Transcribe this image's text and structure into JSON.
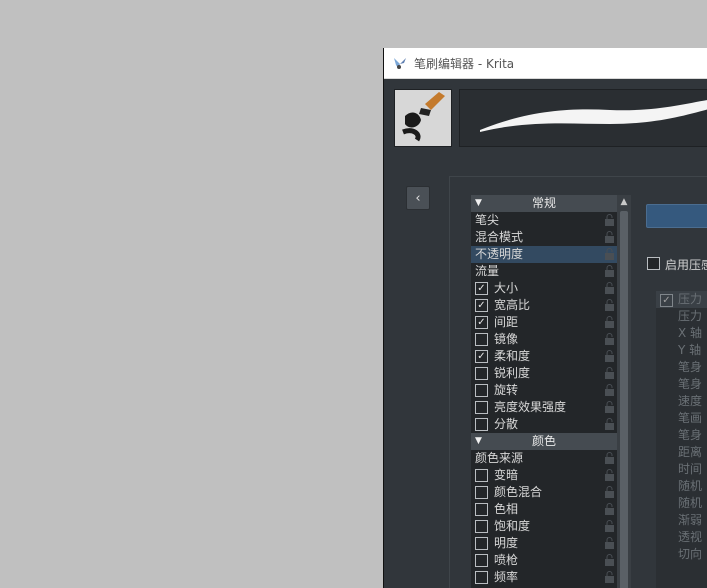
{
  "window": {
    "title": "笔刷编辑器 - Krita"
  },
  "categories": [
    {
      "header": "常规",
      "items": [
        {
          "label": "笔尖",
          "has_checkbox": false,
          "checked": false,
          "selected": false
        },
        {
          "label": "混合模式",
          "has_checkbox": false,
          "checked": false,
          "selected": false
        },
        {
          "label": "不透明度",
          "has_checkbox": false,
          "checked": false,
          "selected": true
        },
        {
          "label": "流量",
          "has_checkbox": false,
          "checked": false,
          "selected": false
        },
        {
          "label": "大小",
          "has_checkbox": true,
          "checked": true,
          "selected": false
        },
        {
          "label": "宽高比",
          "has_checkbox": true,
          "checked": true,
          "selected": false
        },
        {
          "label": "间距",
          "has_checkbox": true,
          "checked": true,
          "selected": false
        },
        {
          "label": "镜像",
          "has_checkbox": true,
          "checked": false,
          "selected": false
        },
        {
          "label": "柔和度",
          "has_checkbox": true,
          "checked": true,
          "selected": false
        },
        {
          "label": "锐利度",
          "has_checkbox": true,
          "checked": false,
          "selected": false
        },
        {
          "label": "旋转",
          "has_checkbox": true,
          "checked": false,
          "selected": false
        },
        {
          "label": "亮度效果强度",
          "has_checkbox": true,
          "checked": false,
          "selected": false
        },
        {
          "label": "分散",
          "has_checkbox": true,
          "checked": false,
          "selected": false
        }
      ]
    },
    {
      "header": "颜色",
      "items": [
        {
          "label": "颜色来源",
          "has_checkbox": false,
          "checked": false,
          "selected": false
        },
        {
          "label": "变暗",
          "has_checkbox": true,
          "checked": false,
          "selected": false
        },
        {
          "label": "颜色混合",
          "has_checkbox": true,
          "checked": false,
          "selected": false
        },
        {
          "label": "色相",
          "has_checkbox": true,
          "checked": false,
          "selected": false
        },
        {
          "label": "饱和度",
          "has_checkbox": true,
          "checked": false,
          "selected": false
        },
        {
          "label": "明度",
          "has_checkbox": true,
          "checked": false,
          "selected": false
        },
        {
          "label": "喷枪",
          "has_checkbox": true,
          "checked": false,
          "selected": false
        },
        {
          "label": "频率",
          "has_checkbox": true,
          "checked": false,
          "selected": false
        }
      ]
    }
  ],
  "pressure": {
    "label": "启用压感"
  },
  "sensors": [
    {
      "label": "压力",
      "checked": true
    },
    {
      "label": "压力",
      "checked": false
    },
    {
      "label": "X 轴",
      "checked": false
    },
    {
      "label": "Y 轴",
      "checked": false
    },
    {
      "label": "笔身",
      "checked": false
    },
    {
      "label": "笔身",
      "checked": false
    },
    {
      "label": "速度",
      "checked": false
    },
    {
      "label": "笔画",
      "checked": false
    },
    {
      "label": "笔身",
      "checked": false
    },
    {
      "label": "距离",
      "checked": false
    },
    {
      "label": "时间",
      "checked": false
    },
    {
      "label": "随机",
      "checked": false
    },
    {
      "label": "随机",
      "checked": false
    },
    {
      "label": "渐弱",
      "checked": false
    },
    {
      "label": "透视",
      "checked": false
    },
    {
      "label": "切向",
      "checked": false
    }
  ],
  "colors": {
    "selection": "#334a61",
    "accent_button": "#35597e"
  }
}
